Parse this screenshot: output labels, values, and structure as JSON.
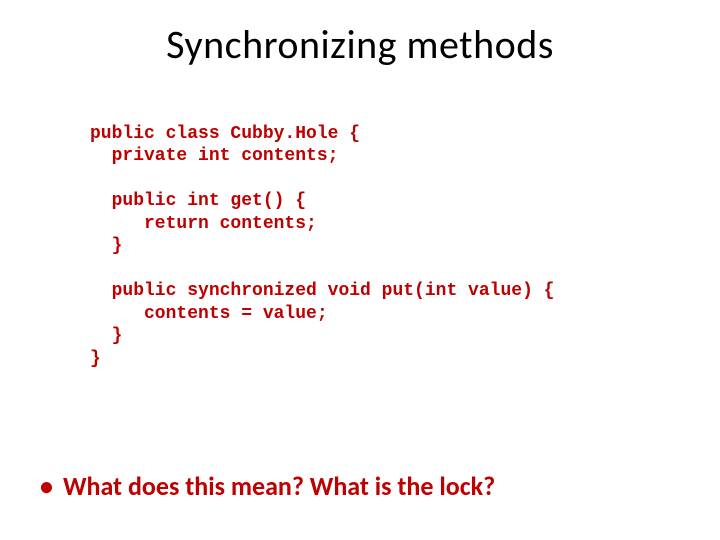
{
  "title": "Synchronizing methods",
  "code": {
    "l1": "public class Cubby.Hole {",
    "l2": "  private int contents;",
    "l3": "",
    "l4": "  public int get() {",
    "l5": "     return contents;",
    "l6": "  }",
    "l7": "",
    "l8": "  public synchronized void put(int value) {",
    "l9": "     contents = value;",
    "l10": "  }",
    "l11": "}"
  },
  "bullet": {
    "marker": "•",
    "text": "What does this mean?  What is the lock?"
  }
}
